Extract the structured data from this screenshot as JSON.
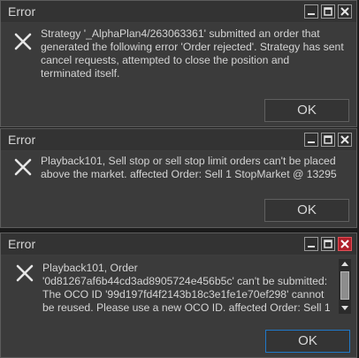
{
  "dialogs": [
    {
      "title": "Error",
      "message": "Strategy '_AlphaPlan4/263063361' submitted an order that\ngenerated the following error 'Order rejected'. Strategy has sent\ncancel requests, attempted to close the position and\nterminated itself.",
      "ok_label": "OK"
    },
    {
      "title": "Error",
      "message": "Playback101, Sell stop or sell stop limit orders can't be placed\nabove the market. affected Order: Sell 1 StopMarket @ 13295",
      "ok_label": "OK"
    },
    {
      "title": "Error",
      "message": "Playback101, Order\n'0d81267af6b44cd3ad8905724e456b5c' can't be submitted:\nThe OCO ID '99d197fd4f2143b18c3e1fe1e70ef298' cannot\nbe reused. Please use a new OCO ID. affected Order: Sell 1",
      "ok_label": "OK"
    }
  ],
  "icons": {
    "error": "x-icon",
    "minimize": "minimize-icon",
    "maximize": "maximize-icon",
    "close": "close-icon"
  },
  "colors": {
    "close_active": "#b0202a",
    "focus_border": "#1f78c8"
  }
}
